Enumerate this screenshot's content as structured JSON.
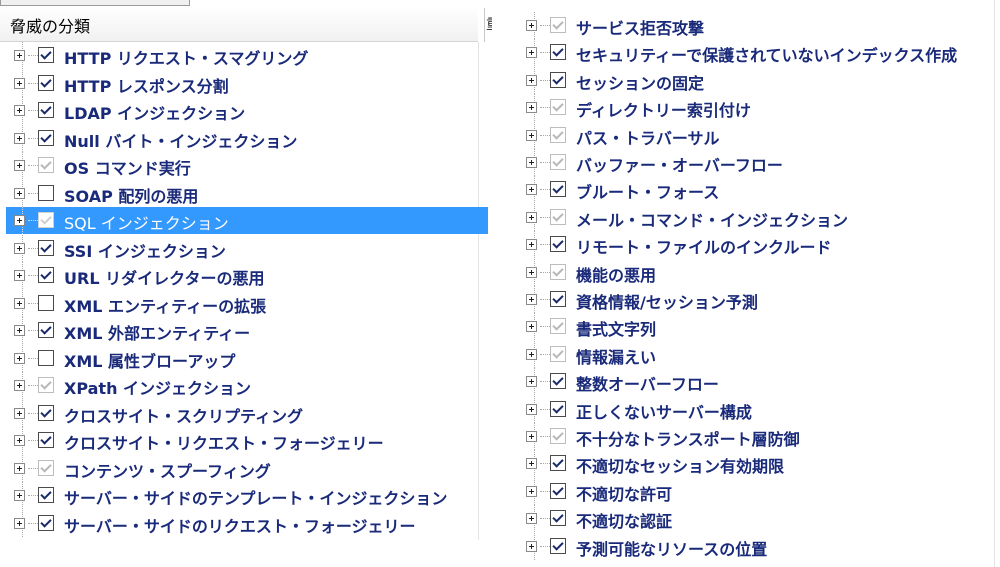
{
  "left_panel": {
    "header": {
      "label": "脅威の分類",
      "edge_text": "重"
    },
    "items": [
      {
        "label": "HTTP リクエスト・スマグリング",
        "checked": true,
        "disabled": false,
        "selected": false
      },
      {
        "label": "HTTP レスポンス分割",
        "checked": true,
        "disabled": false,
        "selected": false
      },
      {
        "label": "LDAP インジェクション",
        "checked": true,
        "disabled": false,
        "selected": false
      },
      {
        "label": "Null バイト・インジェクション",
        "checked": true,
        "disabled": false,
        "selected": false
      },
      {
        "label": "OS コマンド実行",
        "checked": true,
        "disabled": true,
        "selected": false
      },
      {
        "label": "SOAP 配列の悪用",
        "checked": false,
        "disabled": false,
        "selected": false
      },
      {
        "label": "SQL インジェクション",
        "checked": true,
        "disabled": true,
        "selected": true
      },
      {
        "label": "SSI インジェクション",
        "checked": true,
        "disabled": false,
        "selected": false
      },
      {
        "label": "URL リダイレクターの悪用",
        "checked": true,
        "disabled": false,
        "selected": false
      },
      {
        "label": "XML エンティティーの拡張",
        "checked": false,
        "disabled": false,
        "selected": false
      },
      {
        "label": "XML 外部エンティティー",
        "checked": true,
        "disabled": false,
        "selected": false
      },
      {
        "label": "XML 属性ブローアップ",
        "checked": false,
        "disabled": false,
        "selected": false
      },
      {
        "label": "XPath インジェクション",
        "checked": true,
        "disabled": true,
        "selected": false
      },
      {
        "label": "クロスサイト・スクリプティング",
        "checked": true,
        "disabled": false,
        "selected": false
      },
      {
        "label": "クロスサイト・リクエスト・フォージェリー",
        "checked": true,
        "disabled": false,
        "selected": false
      },
      {
        "label": "コンテンツ・スプーフィング",
        "checked": true,
        "disabled": true,
        "selected": false
      },
      {
        "label": "サーバー・サイドのテンプレート・インジェクション",
        "checked": true,
        "disabled": false,
        "selected": false
      },
      {
        "label": "サーバー・サイドのリクエスト・フォージェリー",
        "checked": true,
        "disabled": false,
        "selected": false
      }
    ]
  },
  "right_panel": {
    "items": [
      {
        "label": "サービス拒否攻撃",
        "checked": true,
        "disabled": true
      },
      {
        "label": "セキュリティーで保護されていないインデックス作成",
        "checked": true,
        "disabled": false
      },
      {
        "label": "セッションの固定",
        "checked": true,
        "disabled": false
      },
      {
        "label": "ディレクトリー索引付け",
        "checked": true,
        "disabled": true
      },
      {
        "label": "パス・トラバーサル",
        "checked": true,
        "disabled": true
      },
      {
        "label": "バッファー・オーバーフロー",
        "checked": true,
        "disabled": true
      },
      {
        "label": "ブルート・フォース",
        "checked": true,
        "disabled": false
      },
      {
        "label": "メール・コマンド・インジェクション",
        "checked": true,
        "disabled": true
      },
      {
        "label": "リモート・ファイルのインクルード",
        "checked": true,
        "disabled": false
      },
      {
        "label": "機能の悪用",
        "checked": true,
        "disabled": true
      },
      {
        "label": "資格情報/セッション予測",
        "checked": true,
        "disabled": false
      },
      {
        "label": "書式文字列",
        "checked": true,
        "disabled": true
      },
      {
        "label": "情報漏えい",
        "checked": true,
        "disabled": true
      },
      {
        "label": "整数オーバーフロー",
        "checked": true,
        "disabled": false
      },
      {
        "label": "正しくないサーバー構成",
        "checked": true,
        "disabled": false
      },
      {
        "label": "不十分なトランスポート層防御",
        "checked": true,
        "disabled": true
      },
      {
        "label": "不適切なセッション有効期限",
        "checked": true,
        "disabled": false
      },
      {
        "label": "不適切な許可",
        "checked": true,
        "disabled": false
      },
      {
        "label": "不適切な認証",
        "checked": true,
        "disabled": false
      },
      {
        "label": "予測可能なリソースの位置",
        "checked": true,
        "disabled": false
      }
    ]
  },
  "colors": {
    "label_text": "#1a2a7a",
    "selection_bg": "#3399ff",
    "header_bg": "#f1f1f1"
  },
  "icons": {
    "expander": "plus-box-icon",
    "checkbox": "checkmark-icon"
  }
}
